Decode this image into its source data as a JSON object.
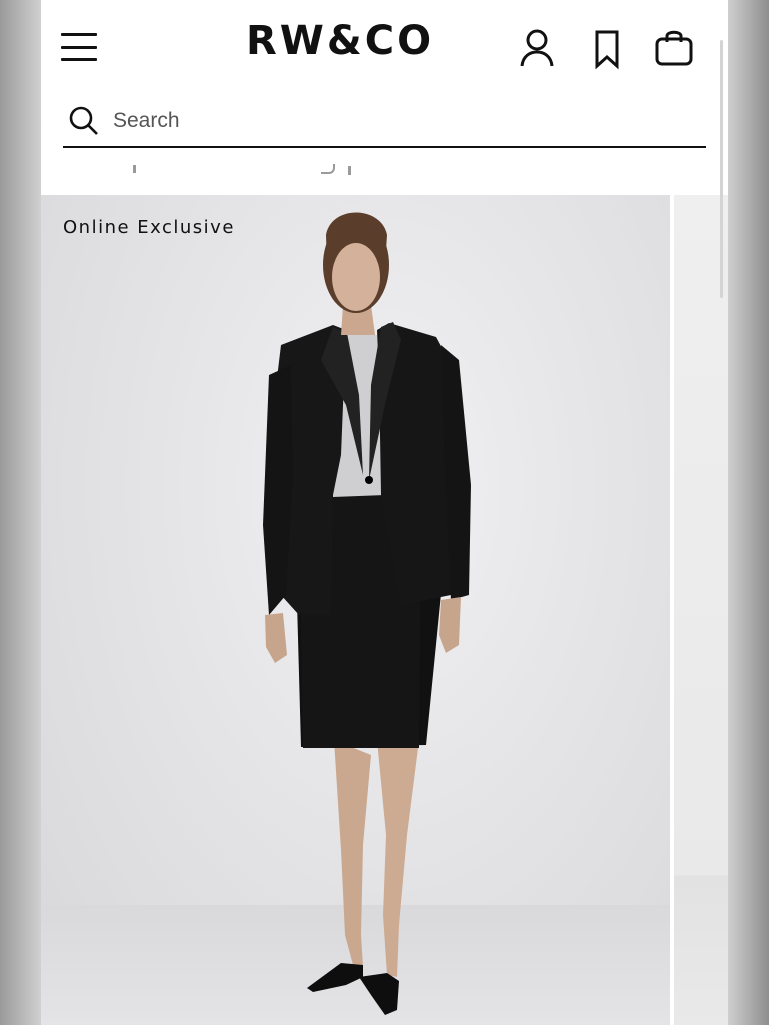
{
  "header": {
    "brand": "RW&CO",
    "menu_icon": "hamburger-menu-icon",
    "account_icon": "account-icon",
    "wishlist_icon": "bookmark-icon",
    "bag_icon": "shopping-bag-icon"
  },
  "search": {
    "placeholder": "Search",
    "value": "",
    "icon": "search-icon"
  },
  "product": {
    "badge": "Online Exclusive"
  },
  "colors": {
    "text": "#111111",
    "background": "#ffffff"
  }
}
